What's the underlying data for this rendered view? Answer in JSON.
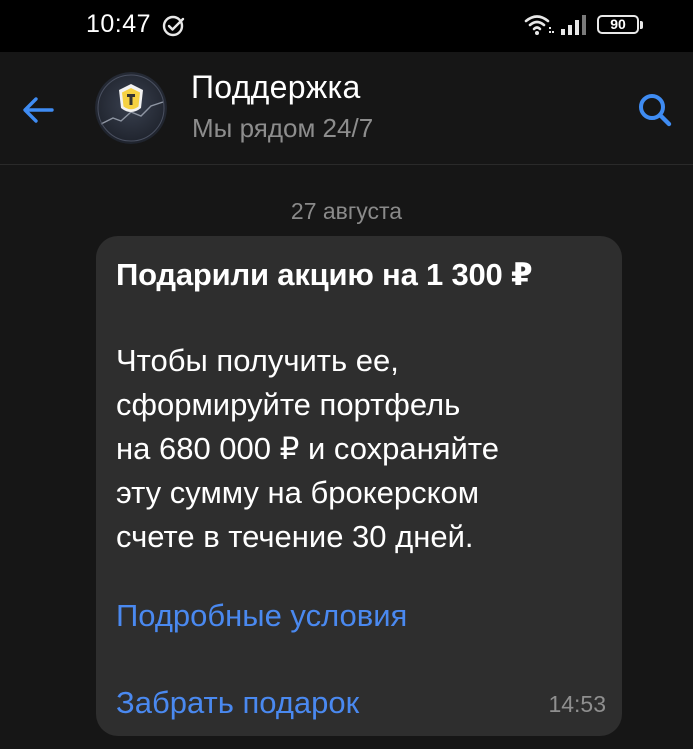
{
  "status_bar": {
    "time": "10:47",
    "battery": "90",
    "icons": [
      "check-circle-icon",
      "wifi-icon",
      "signal-icon",
      "battery-icon"
    ]
  },
  "header": {
    "title": "Поддержка",
    "subtitle": "Мы рядом 24/7",
    "back_icon": "arrow-left-icon",
    "search_icon": "search-icon",
    "accent_color": "#3f8cf3"
  },
  "chat": {
    "date": "27 августа",
    "message": {
      "title": "Подарили акцию на 1 300 ₽",
      "body_lines": [
        "Чтобы получить ее,",
        "сформируйте портфель",
        "на 680 000 ₽ и сохраняйте",
        "эту сумму на брокерском",
        "счете в течение 30 дней."
      ],
      "link_conditions": "Подробные условия",
      "link_gift": "Забрать подарок",
      "time": "14:53",
      "link_color": "#4a89f0",
      "bubble_color": "#2e2e2e"
    }
  }
}
